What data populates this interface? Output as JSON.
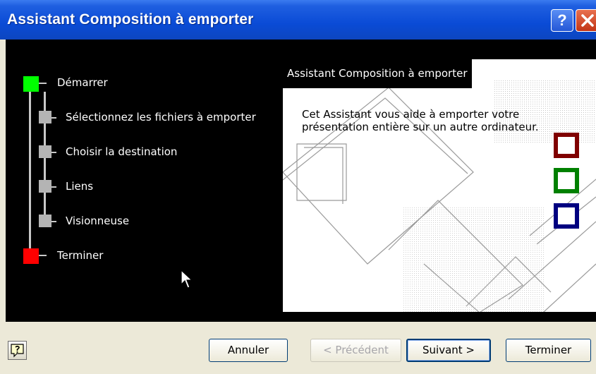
{
  "window": {
    "title": "Assistant Composition à emporter",
    "help_symbol": "?"
  },
  "steps": [
    {
      "label": "Démarrer",
      "state": "start",
      "color": "#00ff00"
    },
    {
      "label": "Sélectionnez les fichiers à emporter",
      "state": "pending",
      "color": "#b4b4b4"
    },
    {
      "label": "Choisir la destination",
      "state": "pending",
      "color": "#b4b4b4"
    },
    {
      "label": "Liens",
      "state": "pending",
      "color": "#b4b4b4"
    },
    {
      "label": "Visionneuse",
      "state": "pending",
      "color": "#b4b4b4"
    },
    {
      "label": "Terminer",
      "state": "end",
      "color": "#ff0000"
    }
  ],
  "content": {
    "title": "Assistant Composition à emporter",
    "description": "Cet Assistant vous aide à emporter votre présentation entière sur un autre ordinateur."
  },
  "decor_squares": [
    {
      "color": "#800000"
    },
    {
      "color": "#008000"
    },
    {
      "color": "#000080"
    }
  ],
  "buttons": {
    "cancel": "Annuler",
    "previous": "< Précédent",
    "next": "Suivant >",
    "finish": "Terminer"
  },
  "icons": {
    "help_button": "help-question-icon",
    "close_button": "close-x-icon",
    "cursor": "mouse-pointer-icon"
  }
}
